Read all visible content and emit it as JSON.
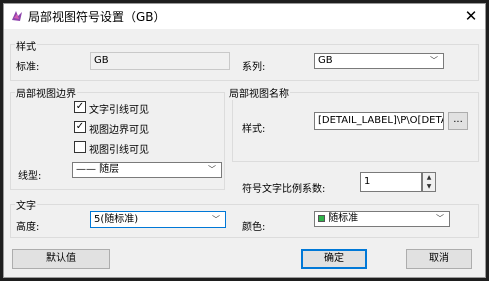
{
  "window": {
    "title": "局部视图符号设置（GB）"
  },
  "style_group": {
    "title": "样式",
    "standard_label": "标准:",
    "standard_value": "GB",
    "series_label": "系列:",
    "series_value": "GB"
  },
  "boundary_group": {
    "title": "局部视图边界",
    "checkboxes": [
      {
        "label": "文字引线可见",
        "checked": true
      },
      {
        "label": "视图边界可见",
        "checked": true
      },
      {
        "label": "视图引线可见",
        "checked": false
      }
    ],
    "linetype_label": "线型:",
    "linetype_value": "—— 随层"
  },
  "name_group": {
    "title": "局部视图名称",
    "style_label": "样式:",
    "style_value": "[DETAIL_LABEL]\\P\\O[DETAIL_",
    "browse_label": "..."
  },
  "scale_factor": {
    "label": "符号文字比例系数:",
    "value": "1"
  },
  "text_group": {
    "title": "文字",
    "height_label": "高度:",
    "height_value": "5(随标准)",
    "color_label": "颜色:",
    "color_value": "随标准",
    "color_swatch": "#2fb34a"
  },
  "buttons": {
    "default": "默认值",
    "ok": "确定",
    "cancel": "取消"
  },
  "colors": {
    "accent": "#0078d7",
    "icon": "#8e44ad"
  }
}
